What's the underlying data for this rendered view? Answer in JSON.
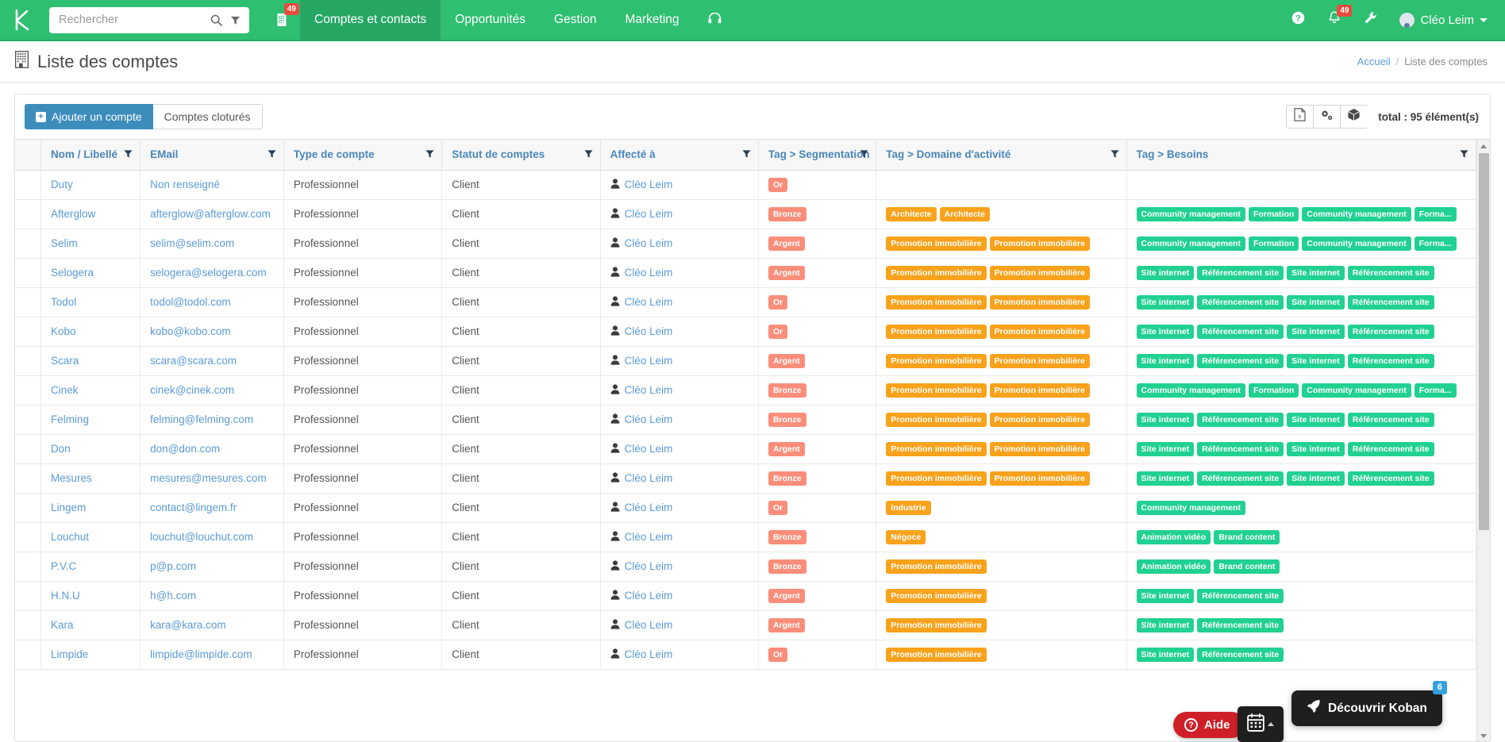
{
  "navbar": {
    "logo_name": "koban-logo",
    "search": {
      "placeholder": "Rechercher",
      "value": ""
    },
    "calendar_badge": "49",
    "items": [
      {
        "label": "Comptes et contacts",
        "active": true
      },
      {
        "label": "Opportunités",
        "active": false
      },
      {
        "label": "Gestion",
        "active": false
      },
      {
        "label": "Marketing",
        "active": false
      }
    ],
    "support_icon": "headset-icon",
    "help_icon": "question-circle-icon",
    "bell_badge": "49",
    "wrench_icon": "wrench-icon",
    "user": {
      "name": "Cléo Leim"
    }
  },
  "page": {
    "title": "Liste des comptes",
    "title_icon": "building-icon",
    "breadcrumb": {
      "home": "Accueil",
      "separator": "/",
      "current": "Liste des comptes"
    }
  },
  "toolbar": {
    "add_label": "Ajouter un compte",
    "closed_accounts_label": "Comptes cloturés",
    "export_icon": "excel-export-icon",
    "settings_icon": "gears-icon",
    "cube_icon": "cube-icon",
    "total_label": "total : 95 élément(s)"
  },
  "table": {
    "columns": [
      {
        "key": "nom",
        "label": "Nom / Libellé",
        "filter": true
      },
      {
        "key": "email",
        "label": "EMail",
        "filter": true
      },
      {
        "key": "type",
        "label": "Type de compte",
        "filter": true
      },
      {
        "key": "statut",
        "label": "Statut de comptes",
        "filter": true
      },
      {
        "key": "affecte",
        "label": "Affecté à",
        "filter": true
      },
      {
        "key": "segmentation",
        "label": "Tag > Segmentation",
        "filter": true
      },
      {
        "key": "domaine",
        "label": "Tag > Domaine d'activité",
        "filter": true
      },
      {
        "key": "besoins",
        "label": "Tag > Besoins",
        "filter": true
      }
    ],
    "rows": [
      {
        "nom": "Duty",
        "email": "Non renseigné",
        "type": "Professionnel",
        "statut": "Client",
        "affecte": "Cléo Leim",
        "segmentation": [
          "Or"
        ],
        "domaine": [],
        "besoins": []
      },
      {
        "nom": "Afterglow",
        "email": "afterglow@afterglow.com",
        "type": "Professionnel",
        "statut": "Client",
        "affecte": "Cléo Leim",
        "segmentation": [
          "Bronze"
        ],
        "domaine": [
          "Architecte",
          "Architecte"
        ],
        "besoins": [
          "Community management",
          "Formation",
          "Community management",
          "Forma..."
        ]
      },
      {
        "nom": "Selim",
        "email": "selim@selim.com",
        "type": "Professionnel",
        "statut": "Client",
        "affecte": "Cléo Leim",
        "segmentation": [
          "Argent"
        ],
        "domaine": [
          "Promotion immobilière",
          "Promotion immobilière"
        ],
        "besoins": [
          "Community management",
          "Formation",
          "Community management",
          "Forma..."
        ]
      },
      {
        "nom": "Selogera",
        "email": "selogera@selogera.com",
        "type": "Professionnel",
        "statut": "Client",
        "affecte": "Cléo Leim",
        "segmentation": [
          "Argent"
        ],
        "domaine": [
          "Promotion immobilière",
          "Promotion immobilière"
        ],
        "besoins": [
          "Site internet",
          "Référencement site",
          "Site internet",
          "Référencement site"
        ]
      },
      {
        "nom": "Todol",
        "email": "todol@todol.com",
        "type": "Professionnel",
        "statut": "Client",
        "affecte": "Cléo Leim",
        "segmentation": [
          "Or"
        ],
        "domaine": [
          "Promotion immobilière",
          "Promotion immobilière"
        ],
        "besoins": [
          "Site internet",
          "Référencement site",
          "Site internet",
          "Référencement site"
        ]
      },
      {
        "nom": "Kobo",
        "email": "kobo@kobo.com",
        "type": "Professionnel",
        "statut": "Client",
        "affecte": "Cléo Leim",
        "segmentation": [
          "Or"
        ],
        "domaine": [
          "Promotion immobilière",
          "Promotion immobilière"
        ],
        "besoins": [
          "Site internet",
          "Référencement site",
          "Site internet",
          "Référencement site"
        ]
      },
      {
        "nom": "Scara",
        "email": "scara@scara.com",
        "type": "Professionnel",
        "statut": "Client",
        "affecte": "Cléo Leim",
        "segmentation": [
          "Argent"
        ],
        "domaine": [
          "Promotion immobilière",
          "Promotion immobilière"
        ],
        "besoins": [
          "Site internet",
          "Référencement site",
          "Site internet",
          "Référencement site"
        ]
      },
      {
        "nom": "Cinek",
        "email": "cinek@cinek.com",
        "type": "Professionnel",
        "statut": "Client",
        "affecte": "Cléo Leim",
        "segmentation": [
          "Bronze"
        ],
        "domaine": [
          "Promotion immobilière",
          "Promotion immobilière"
        ],
        "besoins": [
          "Community management",
          "Formation",
          "Community management",
          "Forma..."
        ]
      },
      {
        "nom": "Felming",
        "email": "felming@felming.com",
        "type": "Professionnel",
        "statut": "Client",
        "affecte": "Cléo Leim",
        "segmentation": [
          "Bronze"
        ],
        "domaine": [
          "Promotion immobilière",
          "Promotion immobilière"
        ],
        "besoins": [
          "Site internet",
          "Référencement site",
          "Site internet",
          "Référencement site"
        ]
      },
      {
        "nom": "Don",
        "email": "don@don.com",
        "type": "Professionnel",
        "statut": "Client",
        "affecte": "Cléo Leim",
        "segmentation": [
          "Argent"
        ],
        "domaine": [
          "Promotion immobilière",
          "Promotion immobilière"
        ],
        "besoins": [
          "Site internet",
          "Référencement site",
          "Site internet",
          "Référencement site"
        ]
      },
      {
        "nom": "Mesures",
        "email": "mesures@mesures.com",
        "type": "Professionnel",
        "statut": "Client",
        "affecte": "Cléo Leim",
        "segmentation": [
          "Bronze"
        ],
        "domaine": [
          "Promotion immobilière",
          "Promotion immobilière"
        ],
        "besoins": [
          "Site internet",
          "Référencement site",
          "Site internet",
          "Référencement site"
        ]
      },
      {
        "nom": "Lingem",
        "email": "contact@lingem.fr",
        "type": "Professionnel",
        "statut": "Client",
        "affecte": "Cléo Leim",
        "segmentation": [
          "Or"
        ],
        "domaine": [
          "Industrie"
        ],
        "besoins": [
          "Community management"
        ]
      },
      {
        "nom": "Louchut",
        "email": "louchut@louchut.com",
        "type": "Professionnel",
        "statut": "Client",
        "affecte": "Cléo Leim",
        "segmentation": [
          "Bronze"
        ],
        "domaine": [
          "Négoce"
        ],
        "besoins": [
          "Animation vidéo",
          "Brand content"
        ]
      },
      {
        "nom": "P.V.C",
        "email": "p@p.com",
        "type": "Professionnel",
        "statut": "Client",
        "affecte": "Cléo Leim",
        "segmentation": [
          "Bronze"
        ],
        "domaine": [
          "Promotion immobilière"
        ],
        "besoins": [
          "Animation vidéo",
          "Brand content"
        ]
      },
      {
        "nom": "H.N.U",
        "email": "h@h.com",
        "type": "Professionnel",
        "statut": "Client",
        "affecte": "Cléo Leim",
        "segmentation": [
          "Argent"
        ],
        "domaine": [
          "Promotion immobilière"
        ],
        "besoins": [
          "Site internet",
          "Référencement site"
        ]
      },
      {
        "nom": "Kara",
        "email": "kara@kara.com",
        "type": "Professionnel",
        "statut": "Client",
        "affecte": "Cléo Leim",
        "segmentation": [
          "Argent"
        ],
        "domaine": [
          "Promotion immobilière"
        ],
        "besoins": [
          "Site internet",
          "Référencement site"
        ]
      },
      {
        "nom": "Limpide",
        "email": "limpide@limpide.com",
        "type": "Professionnel",
        "statut": "Client",
        "affecte": "Cléo Leim",
        "segmentation": [
          "Or"
        ],
        "domaine": [
          "Promotion immobilière"
        ],
        "besoins": [
          "Site internet",
          "Référencement site"
        ]
      }
    ]
  },
  "floating": {
    "help_label": "Aide",
    "calendar_icon": "calendar-icon",
    "discover_label": "Découvrir Koban",
    "discover_badge": "6",
    "rocket_icon": "rocket-icon"
  },
  "colors": {
    "brand_green": "#2fbf71",
    "primary_blue": "#3c8dbc",
    "link_blue": "#5b9bd5",
    "tag_segmentation": "#fa8e7a",
    "tag_domaine": "#f9a21b",
    "tag_besoins": "#21d191",
    "badge_red": "#e74c3c",
    "help_red": "#cf2029"
  }
}
